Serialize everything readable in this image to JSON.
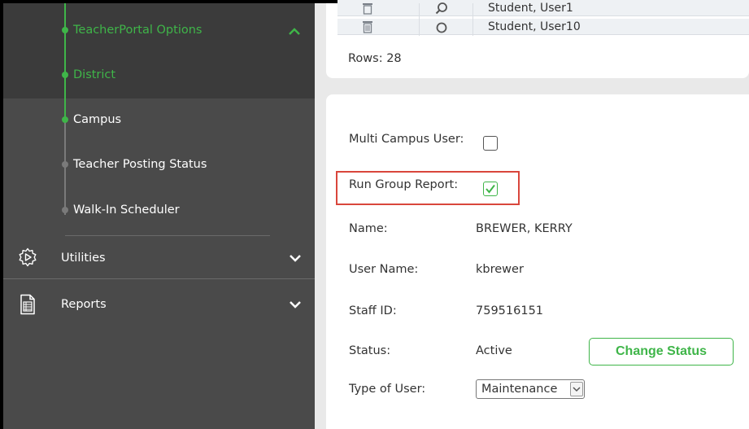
{
  "sidebar": {
    "sub_items": [
      {
        "label": "TeacherPortal Options"
      },
      {
        "label": "District"
      },
      {
        "label": "Campus"
      },
      {
        "label": "Teacher Posting Status"
      },
      {
        "label": "Walk-In Scheduler"
      }
    ],
    "menu": [
      {
        "label": "Utilities",
        "icon": "gear-play-icon"
      },
      {
        "label": "Reports",
        "icon": "document-icon"
      }
    ],
    "bottom_text": "",
    "accent_color": "#3fb549"
  },
  "table": {
    "rows": [
      {
        "name": "Student, User1"
      },
      {
        "name": "Student, User10"
      }
    ],
    "rows_count_label": "Rows: 28"
  },
  "form": {
    "multi_campus_label": "Multi Campus User:",
    "multi_campus_checked": false,
    "run_group_label": "Run Group Report:",
    "run_group_checked": true,
    "name_label": "Name:",
    "name_value": "BREWER, KERRY",
    "username_label": "User Name:",
    "username_value": "kbrewer",
    "staffid_label": "Staff ID:",
    "staffid_value": "759516151",
    "status_label": "Status:",
    "status_value": "Active",
    "change_status_button": "Change Status",
    "type_label": "Type of User:",
    "type_value": "Maintenance"
  }
}
